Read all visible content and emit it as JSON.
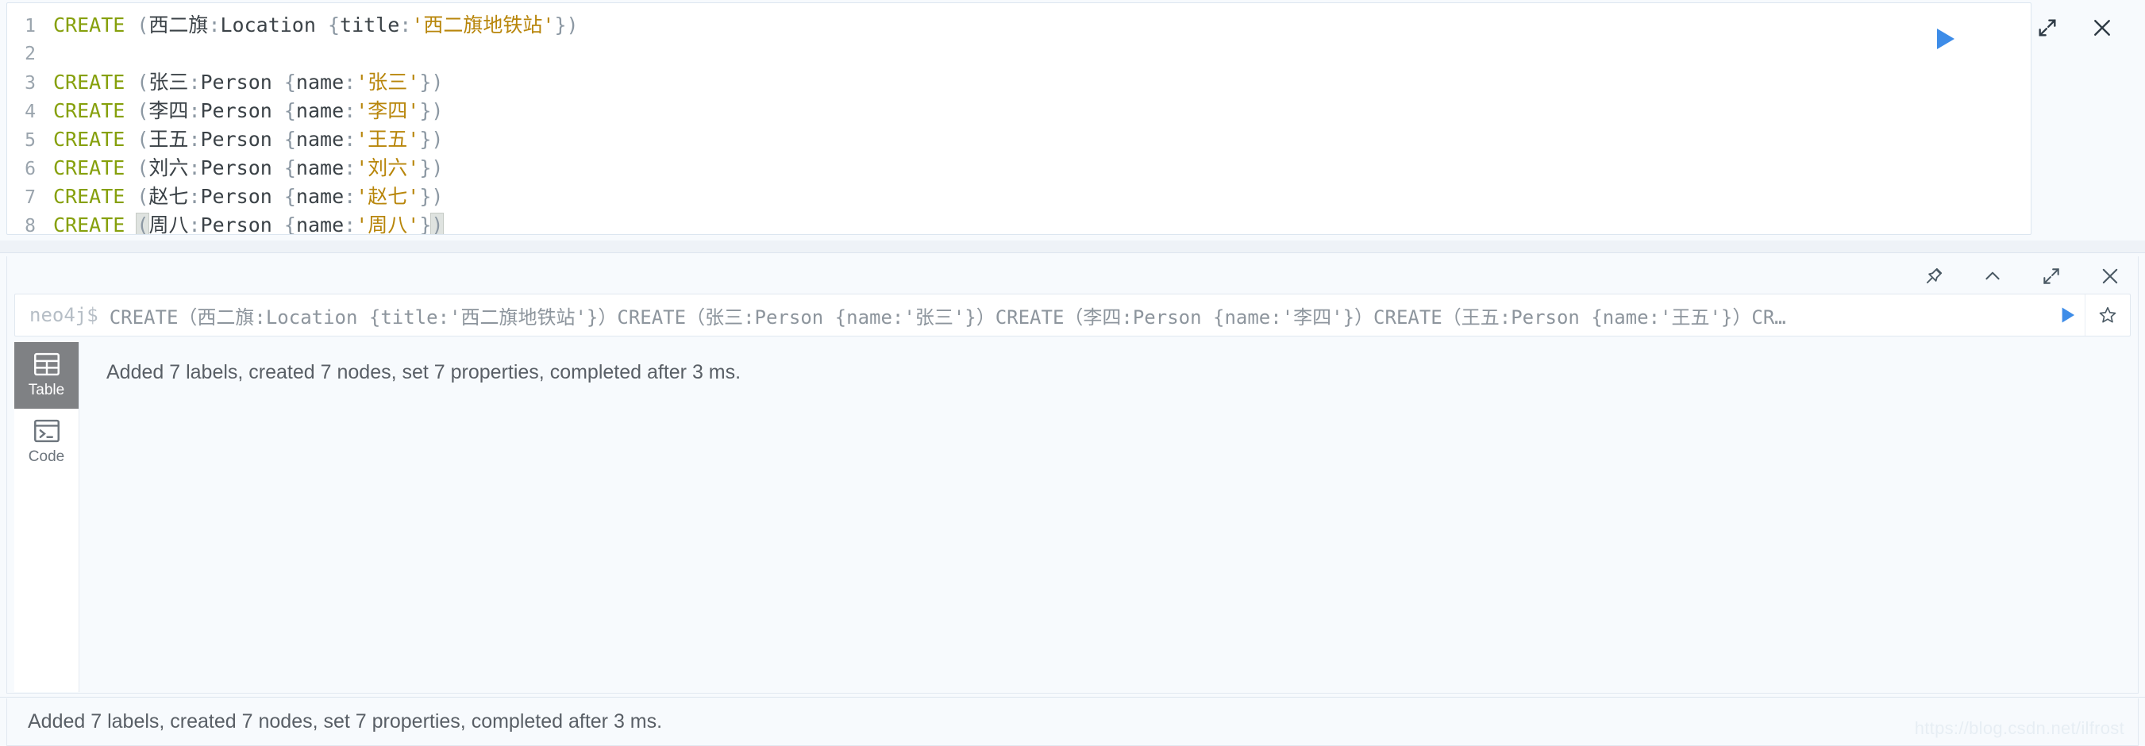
{
  "editor": {
    "lines": [
      {
        "num": "1",
        "tokens": [
          {
            "t": "CREATE",
            "c": "kw"
          },
          {
            "t": " (",
            "c": "punct"
          },
          {
            "t": "西二旗",
            "c": "ident"
          },
          {
            "t": ":",
            "c": "punct"
          },
          {
            "t": "Location",
            "c": "label"
          },
          {
            "t": " {",
            "c": "punct"
          },
          {
            "t": "title",
            "c": "ident"
          },
          {
            "t": ":",
            "c": "punct"
          },
          {
            "t": "'西二旗地铁站'",
            "c": "str"
          },
          {
            "t": "})",
            "c": "punct"
          }
        ]
      },
      {
        "num": "2",
        "tokens": []
      },
      {
        "num": "3",
        "tokens": [
          {
            "t": "CREATE",
            "c": "kw"
          },
          {
            "t": " (",
            "c": "punct"
          },
          {
            "t": "张三",
            "c": "ident"
          },
          {
            "t": ":",
            "c": "punct"
          },
          {
            "t": "Person",
            "c": "label"
          },
          {
            "t": " {",
            "c": "punct"
          },
          {
            "t": "name",
            "c": "ident"
          },
          {
            "t": ":",
            "c": "punct"
          },
          {
            "t": "'张三'",
            "c": "str"
          },
          {
            "t": "})",
            "c": "punct"
          }
        ]
      },
      {
        "num": "4",
        "tokens": [
          {
            "t": "CREATE",
            "c": "kw"
          },
          {
            "t": " (",
            "c": "punct"
          },
          {
            "t": "李四",
            "c": "ident"
          },
          {
            "t": ":",
            "c": "punct"
          },
          {
            "t": "Person",
            "c": "label"
          },
          {
            "t": " {",
            "c": "punct"
          },
          {
            "t": "name",
            "c": "ident"
          },
          {
            "t": ":",
            "c": "punct"
          },
          {
            "t": "'李四'",
            "c": "str"
          },
          {
            "t": "})",
            "c": "punct"
          }
        ]
      },
      {
        "num": "5",
        "tokens": [
          {
            "t": "CREATE",
            "c": "kw"
          },
          {
            "t": " (",
            "c": "punct"
          },
          {
            "t": "王五",
            "c": "ident"
          },
          {
            "t": ":",
            "c": "punct"
          },
          {
            "t": "Person",
            "c": "label"
          },
          {
            "t": " {",
            "c": "punct"
          },
          {
            "t": "name",
            "c": "ident"
          },
          {
            "t": ":",
            "c": "punct"
          },
          {
            "t": "'王五'",
            "c": "str"
          },
          {
            "t": "})",
            "c": "punct"
          }
        ]
      },
      {
        "num": "6",
        "tokens": [
          {
            "t": "CREATE",
            "c": "kw"
          },
          {
            "t": " (",
            "c": "punct"
          },
          {
            "t": "刘六",
            "c": "ident"
          },
          {
            "t": ":",
            "c": "punct"
          },
          {
            "t": "Person",
            "c": "label"
          },
          {
            "t": " {",
            "c": "punct"
          },
          {
            "t": "name",
            "c": "ident"
          },
          {
            "t": ":",
            "c": "punct"
          },
          {
            "t": "'刘六'",
            "c": "str"
          },
          {
            "t": "})",
            "c": "punct"
          }
        ]
      },
      {
        "num": "7",
        "tokens": [
          {
            "t": "CREATE",
            "c": "kw"
          },
          {
            "t": " (",
            "c": "punct"
          },
          {
            "t": "赵七",
            "c": "ident"
          },
          {
            "t": ":",
            "c": "punct"
          },
          {
            "t": "Person",
            "c": "label"
          },
          {
            "t": " {",
            "c": "punct"
          },
          {
            "t": "name",
            "c": "ident"
          },
          {
            "t": ":",
            "c": "punct"
          },
          {
            "t": "'赵七'",
            "c": "str"
          },
          {
            "t": "})",
            "c": "punct"
          }
        ]
      },
      {
        "num": "8",
        "tokens": [
          {
            "t": "CREATE",
            "c": "kw"
          },
          {
            "t": " ",
            "c": "punct"
          },
          {
            "t": "(",
            "c": "punct brmatch"
          },
          {
            "t": "周八",
            "c": "ident"
          },
          {
            "t": ":",
            "c": "punct"
          },
          {
            "t": "Person",
            "c": "label"
          },
          {
            "t": " {",
            "c": "punct"
          },
          {
            "t": "name",
            "c": "ident"
          },
          {
            "t": ":",
            "c": "punct"
          },
          {
            "t": "'周八'",
            "c": "str"
          },
          {
            "t": "}",
            "c": "punct"
          },
          {
            "t": ")",
            "c": "punct brmatch"
          }
        ]
      }
    ],
    "run_icon": "play-icon",
    "controls": [
      {
        "name": "expand-icon",
        "title": "Expand"
      },
      {
        "name": "close-icon",
        "title": "Close"
      }
    ]
  },
  "frame": {
    "controls": [
      {
        "name": "pin-icon",
        "title": "Pin"
      },
      {
        "name": "chevron-up-icon",
        "title": "Collapse"
      },
      {
        "name": "expand-icon",
        "title": "Expand"
      },
      {
        "name": "close-icon",
        "title": "Close"
      }
    ],
    "query": {
      "prompt": "neo4j$",
      "text": "CREATE（西二旗:Location {title:'西二旗地铁站'}）CREATE（张三:Person {name:'张三'}）CREATE（李四:Person {name:'李四'}）CREATE（王五:Person {name:'王五'}）CR…",
      "run_icon": "play-icon",
      "favorite_icon": "star-icon"
    },
    "views": [
      {
        "id": "table",
        "label": "Table",
        "icon": "table-icon",
        "active": true
      },
      {
        "id": "code",
        "label": "Code",
        "icon": "terminal-icon",
        "active": false
      }
    ],
    "result_message": "Added 7 labels, created 7 nodes, set 7 properties, completed after 3 ms."
  },
  "status_bar": {
    "message": "Added 7 labels, created 7 nodes, set 7 properties, completed after 3 ms."
  },
  "watermark": "https://blog.csdn.net/ilfrost",
  "colors": {
    "accent_blue": "#3d8ce8",
    "keyword": "#86a00c",
    "string": "#b8860b",
    "panel_bg": "#f7fafd",
    "active_tab_bg": "#7f8184"
  }
}
